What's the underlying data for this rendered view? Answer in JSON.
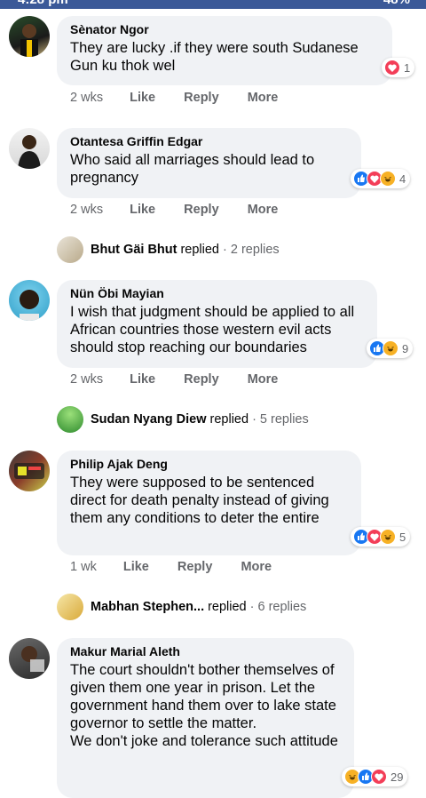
{
  "status_bar": {
    "time": "4:28 pm",
    "battery": "48%"
  },
  "comments": [
    {
      "author": "Sènator Ngor",
      "text": "They are lucky .if they were south Sudanese Gun ku thok wel",
      "time": "2 wks",
      "actions": [
        "Like",
        "Reply",
        "More"
      ],
      "reactions": {
        "icons": [
          "love-icon"
        ],
        "count": "1"
      }
    },
    {
      "author": "Otantesa Griffin Edgar",
      "text": "Who said all marriages should lead to pregnancy",
      "time": "2 wks",
      "actions": [
        "Like",
        "Reply",
        "More"
      ],
      "reactions": {
        "icons": [
          "like-icon",
          "love-icon",
          "haha-icon"
        ],
        "count": "4"
      },
      "replies": {
        "name": "Bhut Gäi Bhut",
        "verb": "replied",
        "count": "· 2 replies"
      }
    },
    {
      "author": "Nün Öbi Mayian",
      "text": "I wish that judgment should be applied to all African countries those western evil acts should stop reaching our boundaries",
      "time": "2 wks",
      "actions": [
        "Like",
        "Reply",
        "More"
      ],
      "reactions": {
        "icons": [
          "like-icon",
          "haha-icon"
        ],
        "count": "9"
      },
      "replies": {
        "name": "Sudan Nyang Diew",
        "verb": "replied",
        "count": "· 5 replies"
      }
    },
    {
      "author": "Philip Ajak Deng",
      "text": "They were supposed to be sentenced direct for death penalty instead of giving them any conditions to deter the entire",
      "time": "1 wk",
      "actions": [
        "Like",
        "Reply",
        "More"
      ],
      "reactions": {
        "icons": [
          "like-icon",
          "love-icon",
          "haha-icon"
        ],
        "count": "5"
      },
      "replies": {
        "name": "Mabhan Stephen...",
        "verb": "replied",
        "count": "· 6 replies"
      }
    },
    {
      "author": "Makur Marial Aleth",
      "text": "The court shouldn't bother themselves of given them one year in prison. Let the government hand them over to lake state governor to settle the matter.\nWe don't joke and tolerance such attitude",
      "reactions": {
        "icons": [
          "haha-icon",
          "like-icon",
          "love-icon"
        ],
        "count": "29"
      }
    }
  ],
  "colors": {
    "bubble": "#f0f2f5",
    "meta": "#65676b",
    "like": "#1877f2",
    "love": "#f33e58",
    "haha": "#f7b125"
  }
}
